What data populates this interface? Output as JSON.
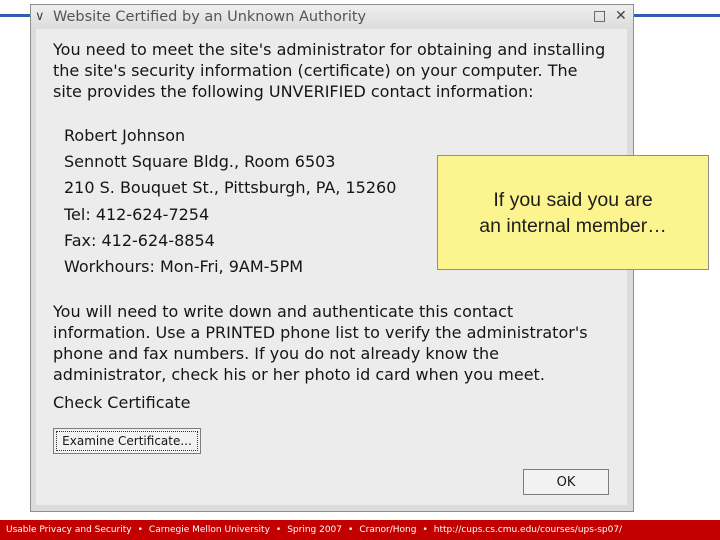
{
  "dialog": {
    "title": "Website Certified by an Unknown Authority",
    "menu_glyph": "∨",
    "maximize_glyph": "□",
    "close_glyph": "✕",
    "intro": [
      "You need to meet the site's administrator for obtaining and installing",
      "the site's security information (certificate) on your computer. The",
      "site provides the following UNVERIFIED contact information:"
    ],
    "contact": [
      "Robert Johnson",
      "Sennott Square Bldg., Room 6503",
      "210 S. Bouquet St., Pittsburgh, PA, 15260",
      "Tel: 412-624-7254",
      "Fax: 412-624-8854",
      "Workhours: Mon-Fri, 9AM-5PM"
    ],
    "instructions": [
      "You will need to write down and authenticate this contact",
      "information. Use a PRINTED phone list to verify the administrator's",
      "phone and fax numbers. If you do not already know the",
      "administrator, check his or her photo id card when you meet."
    ],
    "check_label": "Check Certificate",
    "examine_button": "Examine Certificate...",
    "ok_button": "OK"
  },
  "callout": {
    "line1": "If you said you are",
    "line2": "an internal member…"
  },
  "footer": {
    "items": [
      "Usable Privacy and Security",
      "Carnegie Mellon University",
      "Spring 2007",
      "Cranor/Hong",
      "http://cups.cs.cmu.edu/courses/ups-sp07/"
    ],
    "separator": "•"
  }
}
